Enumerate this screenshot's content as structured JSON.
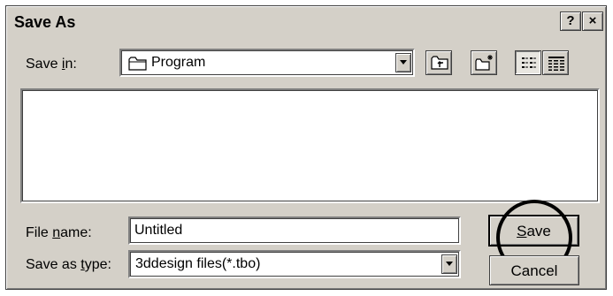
{
  "window": {
    "title": "Save As",
    "help_label": "?",
    "close_label": "×"
  },
  "save_in": {
    "label_pre": "Save ",
    "label_accel": "i",
    "label_post": "n:",
    "value": "Program"
  },
  "toolbar": {
    "up_icon": "up-one-level-icon",
    "new_folder_icon": "new-folder-icon",
    "list_icon": "list-view-icon",
    "details_icon": "details-view-icon"
  },
  "file_name": {
    "label_pre": "File ",
    "label_accel": "n",
    "label_post": "ame:",
    "value": "Untitled"
  },
  "save_type": {
    "label_pre": "Save as ",
    "label_accel": "t",
    "label_post": "ype:",
    "value": "3ddesign files(*.tbo)"
  },
  "buttons": {
    "save_accel": "S",
    "save_rest": "ave",
    "cancel": "Cancel"
  }
}
